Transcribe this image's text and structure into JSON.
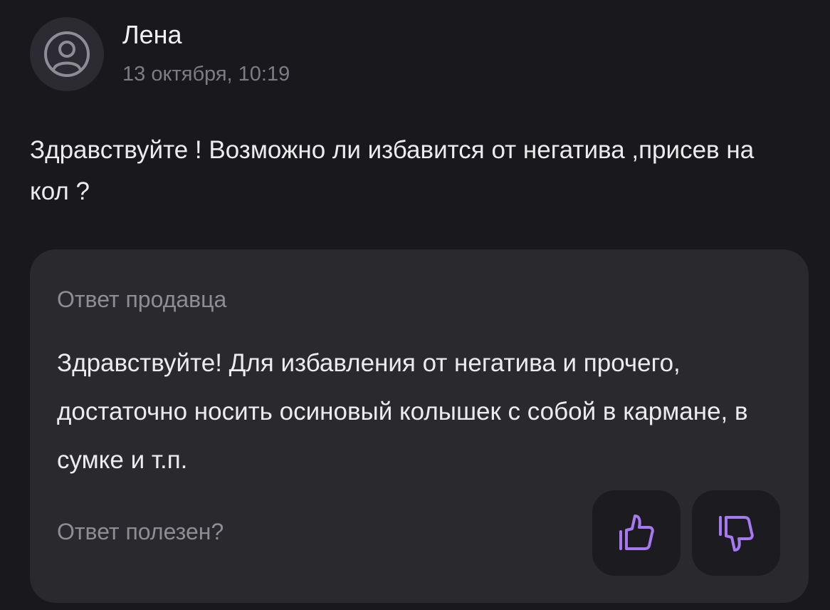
{
  "review": {
    "author": "Лена",
    "date": "13 октября, 10:19",
    "text": "Здравствуйте ! Возможно ли избавится от негатива ,присев на кол ?"
  },
  "seller_answer": {
    "title": "Ответ продавца",
    "text": "Здравствуйте! Для избавления от негатива и прочего, достаточно носить осиновый колышек с собой в кармане, в сумке и т.п.",
    "helpful_question": "Ответ полезен?"
  },
  "icons": {
    "avatar": "user-circle-icon",
    "like": "thumbs-up-icon",
    "dislike": "thumbs-down-icon"
  },
  "colors": {
    "background": "#19181c",
    "card": "#2a292e",
    "accent_purple": "#a679f2"
  }
}
